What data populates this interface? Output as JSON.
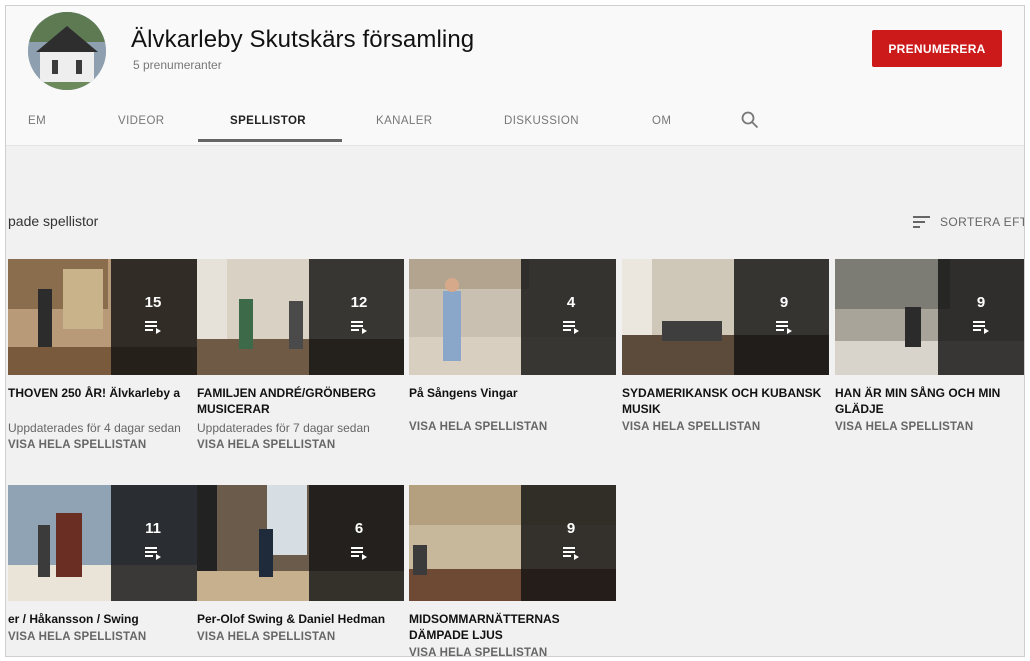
{
  "channel": {
    "name": "Älvkarleby Skutskärs församling",
    "subscribers": "5 prenumeranter",
    "subscribe_label": "PRENUMERERA"
  },
  "tabs": [
    {
      "label": "EM"
    },
    {
      "label": "VIDEOR"
    },
    {
      "label": "SPELLISTOR",
      "active": true
    },
    {
      "label": "KANALER"
    },
    {
      "label": "DISKUSSION"
    },
    {
      "label": "OM"
    }
  ],
  "icons": {
    "search": "search-icon",
    "sort": "sort-icon",
    "playlist": "playlist-icon"
  },
  "section": {
    "title": "pade spellistor",
    "sort_label": "SORTERA EFTER"
  },
  "colors": {
    "subscribe": "#cc1a1a",
    "overlay": "#141414",
    "background": "#f1f1f1"
  },
  "playlists": [
    {
      "title": "THOVEN 250 ÅR! Älvkarleby a",
      "count": "15",
      "updated": "Uppdaterades för 4 dagar sedan",
      "link": "VISA HELA SPELLISTAN"
    },
    {
      "title": "FAMILJEN ANDRÉ/GRÖNBERG MUSICERAR",
      "count": "12",
      "updated": "Uppdaterades för 7 dagar sedan",
      "link": "VISA HELA SPELLISTAN"
    },
    {
      "title": "På Sångens Vingar",
      "count": "4",
      "updated": "",
      "link": "VISA HELA SPELLISTAN"
    },
    {
      "title": "SYDAMERIKANSK OCH KUBANSK MUSIK",
      "count": "9",
      "updated": "",
      "link": "VISA HELA SPELLISTAN"
    },
    {
      "title": "HAN ÄR MIN SÅNG OCH MIN GLÄDJE",
      "count": "9",
      "updated": "",
      "link": "VISA HELA SPELLISTAN"
    },
    {
      "title": "er / Håkansson / Swing",
      "count": "11",
      "updated": "",
      "link": "VISA HELA SPELLISTAN"
    },
    {
      "title": "Per-Olof Swing & Daniel Hedman",
      "count": "6",
      "updated": "",
      "link": "VISA HELA SPELLISTAN"
    },
    {
      "title": "MIDSOMMARNÄTTERNAS DÄMPADE LJUS",
      "count": "9",
      "updated": "",
      "link": "VISA HELA SPELLISTAN"
    }
  ]
}
